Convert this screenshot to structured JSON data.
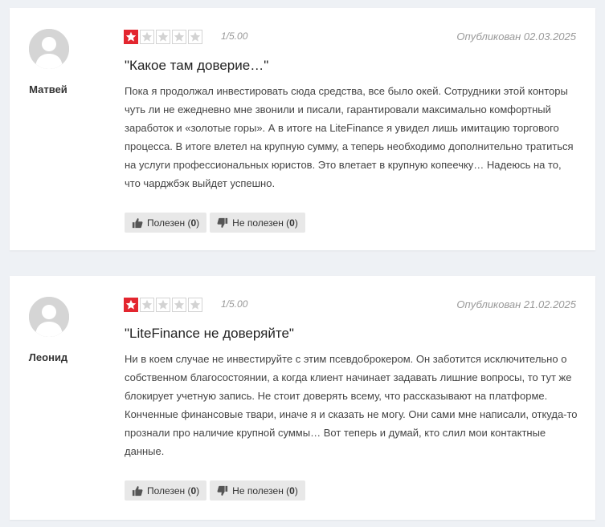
{
  "reviews": [
    {
      "author": "Матвей",
      "rating_value": 1,
      "rating_max": 5,
      "score_text": "1/5.00",
      "published": "Опубликован 02.03.2025",
      "title": "\"Какое там доверие…\"",
      "body": "Пока я продолжал инвестировать сюда средства, все было окей. Сотрудники этой конторы чуть ли не ежедневно мне звонили и писали, гарантировали максимально комфортный заработок и «золотые горы». А в итоге на LiteFinance я увидел лишь имитацию торгового процесса. В итоге влетел на крупную сумму, а теперь необходимо дополнительно тратиться на услуги профессиональных юристов. Это влетает в крупную копеечку… Надеюсь на то, что чарджбэк выйдет успешно.",
      "helpful_label": "Полезен",
      "helpful_count": "0",
      "not_helpful_label": "Не полезен",
      "not_helpful_count": "0"
    },
    {
      "author": "Леонид",
      "rating_value": 1,
      "rating_max": 5,
      "score_text": "1/5.00",
      "published": "Опубликован 21.02.2025",
      "title": "\"LiteFinance не доверяйте\"",
      "body": "Ни в коем случае не инвестируйте с этим псевдоброкером. Он заботится исключительно о собственном благосостоянии, а когда клиент начинает задавать лишние вопросы, то тут же блокирует учетную запись. Не стоит доверять всему, что рассказывают на платформе. Конченные финансовые твари, иначе я и сказать не могу. Они сами мне написали, откуда-то прознали про наличие крупной суммы… Вот теперь и думай, кто слил мои контактные данные.",
      "helpful_label": "Полезен",
      "helpful_count": "0",
      "not_helpful_label": "Не полезен",
      "not_helpful_count": "0"
    }
  ],
  "colors": {
    "star_filled": "#e3262f",
    "star_empty_border": "#d3d3d3",
    "page_background": "#eef1f5"
  },
  "icons": {
    "star": "star-icon",
    "thumb_up": "thumbs-up-icon",
    "thumb_down": "thumbs-down-icon",
    "avatar": "user-silhouette-icon"
  }
}
